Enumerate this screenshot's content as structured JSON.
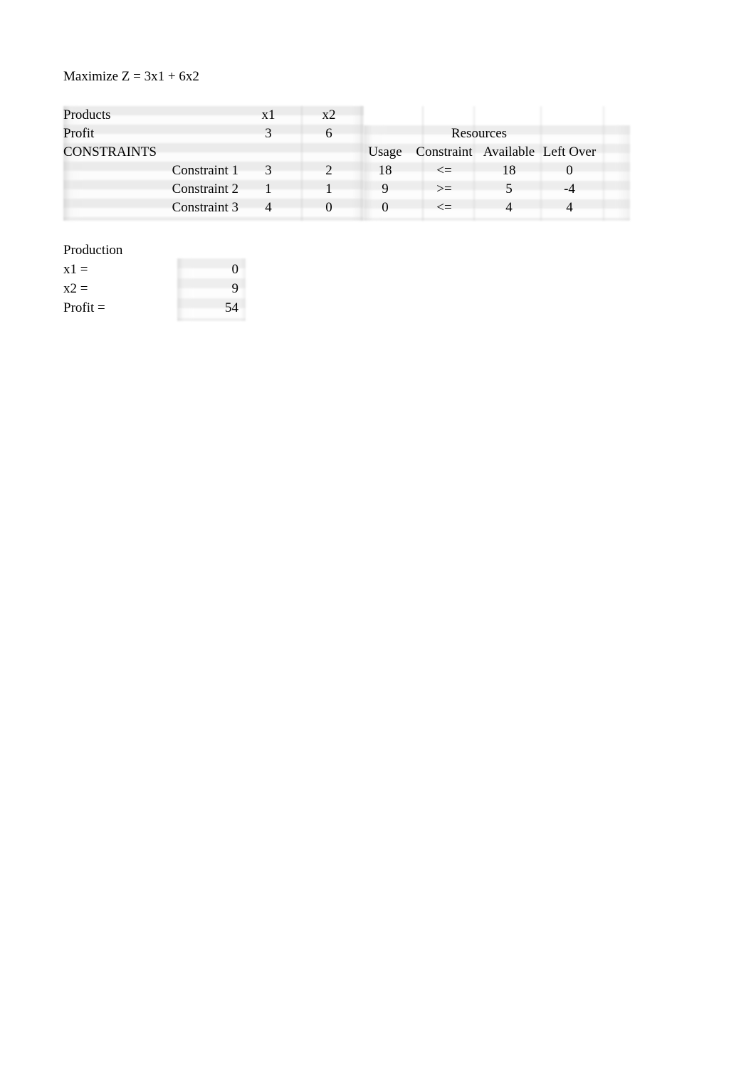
{
  "objective": "Maximize Z = 3x1 + 6x2",
  "worksheet": {
    "row_products": {
      "label": "Products",
      "x1": "x1",
      "x2": "x2"
    },
    "row_profit": {
      "label": "Profit",
      "x1": "3",
      "x2": "6"
    },
    "row_constraints_title": {
      "label": "CONSTRAINTS"
    },
    "resources_header": "Resources",
    "resource_columns": {
      "usage": "Usage",
      "constraint": "Constraint",
      "available": "Available",
      "left_over": "Left Over"
    },
    "constraint_rows": [
      {
        "label": "Constraint 1",
        "x1": "3",
        "x2": "2",
        "usage": "18",
        "constraint": "<=",
        "available": "18",
        "left_over": "0"
      },
      {
        "label": "Constraint 2",
        "x1": "1",
        "x2": "1",
        "usage": "9",
        "constraint": ">=",
        "available": "5",
        "left_over": "-4"
      },
      {
        "label": "Constraint 3",
        "x1": "4",
        "x2": "0",
        "usage": "0",
        "constraint": "<=",
        "available": "4",
        "left_over": "4"
      }
    ]
  },
  "production": {
    "title": "Production",
    "rows": [
      {
        "label": "x1 =",
        "value": "0"
      },
      {
        "label": "x2 =",
        "value": "9"
      },
      {
        "label": "Profit =",
        "value": "54"
      }
    ]
  }
}
